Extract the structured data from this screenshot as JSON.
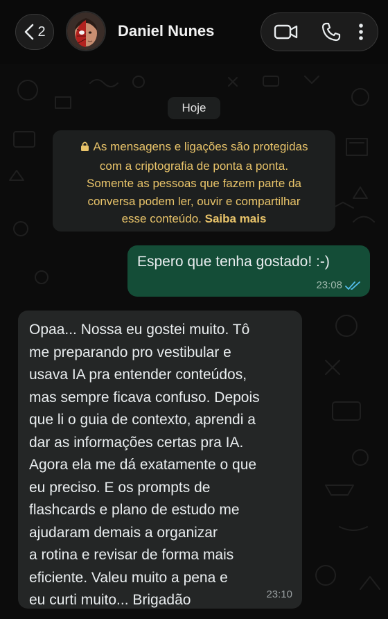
{
  "header": {
    "back_count": "2",
    "contact_name": "Daniel Nunes",
    "icons": [
      "chevron-left-icon",
      "video-call-icon",
      "phone-icon",
      "more-vertical-icon"
    ]
  },
  "date_divider": "Hoje",
  "encryption_notice": {
    "line1": "As mensagens e ligações são protegidas",
    "line2": "com a criptografia de ponta a ponta.",
    "line3": "Somente as pessoas que fazem parte da",
    "line4": "conversa podem ler, ouvir e compartilhar",
    "line5": "esse conteúdo.",
    "link": "Saiba mais",
    "color": "#e9c46a"
  },
  "messages": [
    {
      "direction": "outgoing",
      "text": "Espero que tenha gostado! :-)",
      "time": "23:08",
      "status": "read"
    },
    {
      "direction": "incoming",
      "lines": [
        "Opaa... Nossa eu gostei muito. Tô",
        "me preparando pro vestibular e",
        "usava IA pra entender conteúdos,",
        "mas sempre ficava confuso. Depois",
        "que li o guia de contexto, aprendi a",
        "dar as informações certas pra IA.",
        "Agora ela me dá exatamente o que",
        "eu preciso. E os prompts de",
        "flashcards e plano de estudo me",
        "ajudaram demais a organizar",
        "a rotina e revisar de forma mais",
        "eficiente. Valeu muito a pena e",
        "eu curti muito... Brigadão"
      ],
      "time": "23:10"
    }
  ],
  "colors": {
    "outgoing_bubble": "#144d37",
    "incoming_bubble": "#242626",
    "read_ticks": "#53bdeb"
  }
}
